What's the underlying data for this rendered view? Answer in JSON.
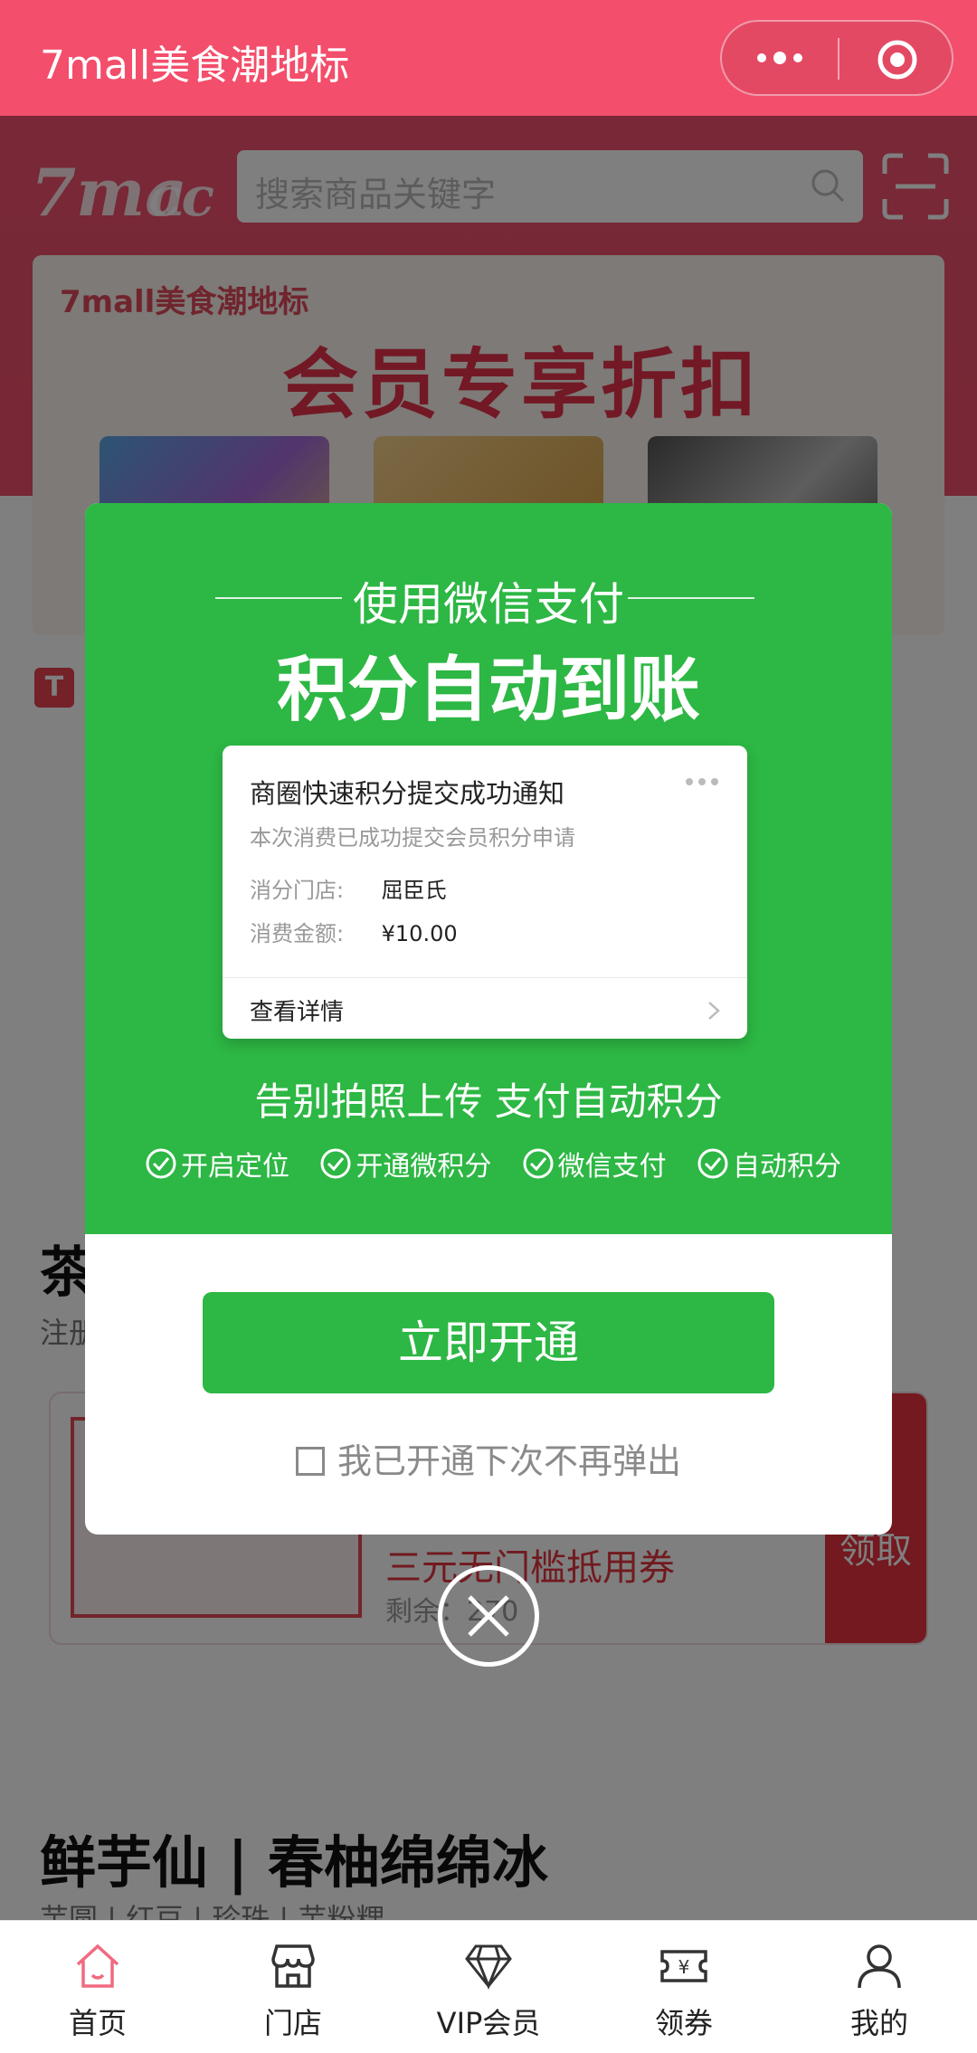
{
  "navbar": {
    "title": "7mall美食潮地标"
  },
  "header": {
    "search_placeholder": "搜索商品关键字",
    "logo": "7maсс"
  },
  "banner": {
    "brand": "7mall美食潮地标",
    "title": "会员专享折扣"
  },
  "tag": {
    "label": "T"
  },
  "section1": {
    "title": "茶",
    "sub": "注册"
  },
  "coupon": {
    "name": "三元无门槛抵用券",
    "remain": "剩余：270",
    "claim": "领取"
  },
  "section2": {
    "title": "鲜芋仙 | 春柚绵绵冰",
    "sub": "芋圆 | 红豆 | 珍珠 | 芋粉粿"
  },
  "modal": {
    "subtitle": "使用微信支付",
    "title": "积分自动到账",
    "notice": {
      "title": "商圈快速积分提交成功通知",
      "desc": "本次消费已成功提交会员积分申请",
      "store_label": "消分门店:",
      "store_value": "屈臣氏",
      "amount_label": "消费金额:",
      "amount_value": "¥10.00",
      "detail": "查看详情"
    },
    "slogan": "告别拍照上传   支付自动积分",
    "steps": [
      "开启定位",
      "开通微积分",
      "微信支付",
      "自动积分"
    ],
    "open_button": "立即开通",
    "dont_show": "我已开通下次不再弹出"
  },
  "tabbar": [
    {
      "label": "首页",
      "icon": "home-icon"
    },
    {
      "label": "门店",
      "icon": "store-icon"
    },
    {
      "label": "VIP会员",
      "icon": "diamond-icon"
    },
    {
      "label": "领券",
      "icon": "coupon-icon"
    },
    {
      "label": "我的",
      "icon": "user-icon"
    }
  ],
  "colors": {
    "brand": "#f34e6b",
    "green": "#2db744",
    "home_active": "#f06a80"
  }
}
